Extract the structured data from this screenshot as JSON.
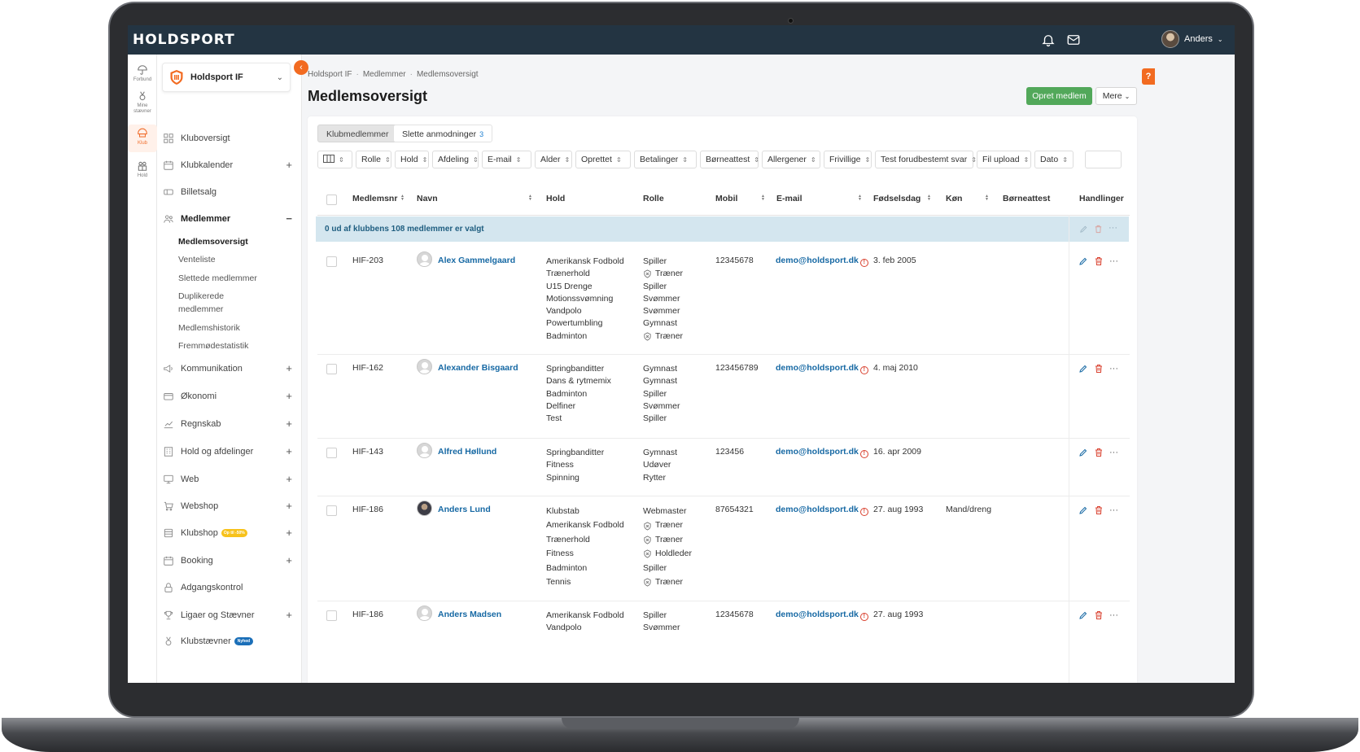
{
  "app": {
    "logo": "HOLDSPORT",
    "user_name": "Anders",
    "colors": {
      "topbar": "#233442",
      "accent": "#f26b21",
      "primary_button": "#52a85a",
      "link": "#1769a4",
      "selection_bar": "#d4e6ef"
    }
  },
  "rail": [
    {
      "label": "Forbund",
      "icon": "umbrella-icon"
    },
    {
      "label": "Mine stævner",
      "icon": "medal-icon"
    },
    {
      "label": "Klub",
      "icon": "club-icon"
    },
    {
      "label": "Hold",
      "icon": "team-icon"
    }
  ],
  "sidebar": {
    "club_name": "Holdsport IF",
    "items": [
      {
        "label": "Kluboversigt",
        "icon": "grid-icon",
        "plus": ""
      },
      {
        "label": "Klubkalender",
        "icon": "calendar-icon",
        "plus": "+"
      },
      {
        "label": "Billetsalg",
        "icon": "ticket-icon",
        "plus": ""
      },
      {
        "label": "Medlemmer",
        "icon": "users-icon",
        "plus": "−"
      },
      {
        "label": "Kommunikation",
        "icon": "megaphone-icon",
        "plus": "+"
      },
      {
        "label": "Økonomi",
        "icon": "wallet-icon",
        "plus": "+"
      },
      {
        "label": "Regnskab",
        "icon": "chart-icon",
        "plus": "+"
      },
      {
        "label": "Hold og afdelinger",
        "icon": "building-icon",
        "plus": "+"
      },
      {
        "label": "Web",
        "icon": "monitor-icon",
        "plus": "+"
      },
      {
        "label": "Webshop",
        "icon": "cart-icon",
        "plus": "+"
      },
      {
        "label": "Klubshop",
        "icon": "shop-icon",
        "plus": "+",
        "badge": "Op til -50%"
      },
      {
        "label": "Booking",
        "icon": "booking-icon",
        "plus": "+"
      },
      {
        "label": "Adgangskontrol",
        "icon": "lock-icon",
        "plus": ""
      },
      {
        "label": "Ligaer og Stævner",
        "icon": "trophy-icon",
        "plus": "+"
      },
      {
        "label": "Klubstævner",
        "icon": "medal-icon",
        "plus": "",
        "badge": "Nyhed"
      }
    ],
    "sub_items": [
      "Medlemsoversigt",
      "Venteliste",
      "Slettede medlemmer",
      "Duplikerede",
      "medlemmer",
      "Medlemshistorik",
      "Fremmødestatistik"
    ]
  },
  "main": {
    "breadcrumb": [
      "Holdsport IF",
      "Medlemmer",
      "Medlemsoversigt"
    ],
    "title": "Medlemsoversigt",
    "create_button": "Opret medlem",
    "more_button": "Mere",
    "help": "?",
    "tabs": [
      {
        "label": "Klubmedlemmer",
        "count": ""
      },
      {
        "label": "Slette anmodninger",
        "count": "3"
      }
    ],
    "filters": [
      "Rolle",
      "Hold",
      "Afdeling",
      "E-mail",
      "Alder",
      "Oprettet",
      "Betalinger",
      "Børneattest",
      "Allergener",
      "Frivillige",
      "Test forudbestemt svar",
      "Fil upload",
      "Dato"
    ],
    "columns": [
      "Medlemsnr",
      "Navn",
      "Hold",
      "Rolle",
      "Mobil",
      "E-mail",
      "Fødselsdag",
      "Køn",
      "Børneattest",
      "Handlinger"
    ],
    "selection_text": "0 ud af klubbens 108 medlemmer er valgt",
    "rows": [
      {
        "id": "HIF-203",
        "name": "Alex Gammelgaard",
        "photo": false,
        "teams": [
          "Amerikansk Fodbold",
          "Trænerhold",
          "U15 Drenge",
          "Motionssvømning",
          "Vandpolo",
          "Powertumbling",
          "Badminton"
        ],
        "roles": [
          {
            "t": "Spiller",
            "i": false
          },
          {
            "t": "Træner",
            "i": true
          },
          {
            "t": "Spiller",
            "i": false
          },
          {
            "t": "Svømmer",
            "i": false
          },
          {
            "t": "Svømmer",
            "i": false
          },
          {
            "t": "Gymnast",
            "i": false
          },
          {
            "t": "Træner",
            "i": true
          }
        ],
        "mobile": "12345678",
        "email": "demo@holdsport.dk",
        "birthday": "3. feb 2005",
        "gender": ""
      },
      {
        "id": "HIF-162",
        "name": "Alexander Bisgaard",
        "photo": false,
        "teams": [
          "Springbanditter",
          "Dans & rytmemix",
          "Badminton",
          "Delfiner",
          "Test"
        ],
        "roles": [
          {
            "t": "Gymnast",
            "i": false
          },
          {
            "t": "Gymnast",
            "i": false
          },
          {
            "t": "Spiller",
            "i": false
          },
          {
            "t": "Svømmer",
            "i": false
          },
          {
            "t": "Spiller",
            "i": false
          }
        ],
        "mobile": "123456789",
        "email": "demo@holdsport.dk",
        "birthday": "4. maj 2010",
        "gender": ""
      },
      {
        "id": "HIF-143",
        "name": "Alfred Høllund",
        "photo": false,
        "teams": [
          "Springbanditter",
          "Fitness",
          "Spinning"
        ],
        "roles": [
          {
            "t": "Gymnast",
            "i": false
          },
          {
            "t": "Udøver",
            "i": false
          },
          {
            "t": "Rytter",
            "i": false
          }
        ],
        "mobile": "123456",
        "email": "demo@holdsport.dk",
        "birthday": "16. apr 2009",
        "gender": ""
      },
      {
        "id": "HIF-186",
        "name": "Anders Lund",
        "photo": true,
        "teams": [
          "Klubstab",
          "Amerikansk Fodbold",
          "Trænerhold",
          "Fitness",
          "Badminton",
          "Tennis"
        ],
        "roles": [
          {
            "t": "Webmaster",
            "i": false
          },
          {
            "t": "Træner",
            "i": true
          },
          {
            "t": "Træner",
            "i": true
          },
          {
            "t": "Holdleder",
            "i": true
          },
          {
            "t": "Spiller",
            "i": false
          },
          {
            "t": "Træner",
            "i": true
          }
        ],
        "mobile": "87654321",
        "email": "demo@holdsport.dk",
        "birthday": "27. aug 1993",
        "gender": "Mand/dreng"
      },
      {
        "id": "HIF-186",
        "name": "Anders Madsen",
        "photo": false,
        "teams": [
          "Amerikansk Fodbold",
          "Vandpolo"
        ],
        "roles": [
          {
            "t": "Spiller",
            "i": false
          },
          {
            "t": "Svømmer",
            "i": false
          }
        ],
        "mobile": "12345678",
        "email": "demo@holdsport.dk",
        "birthday": "27. aug 1993",
        "gender": ""
      }
    ]
  }
}
